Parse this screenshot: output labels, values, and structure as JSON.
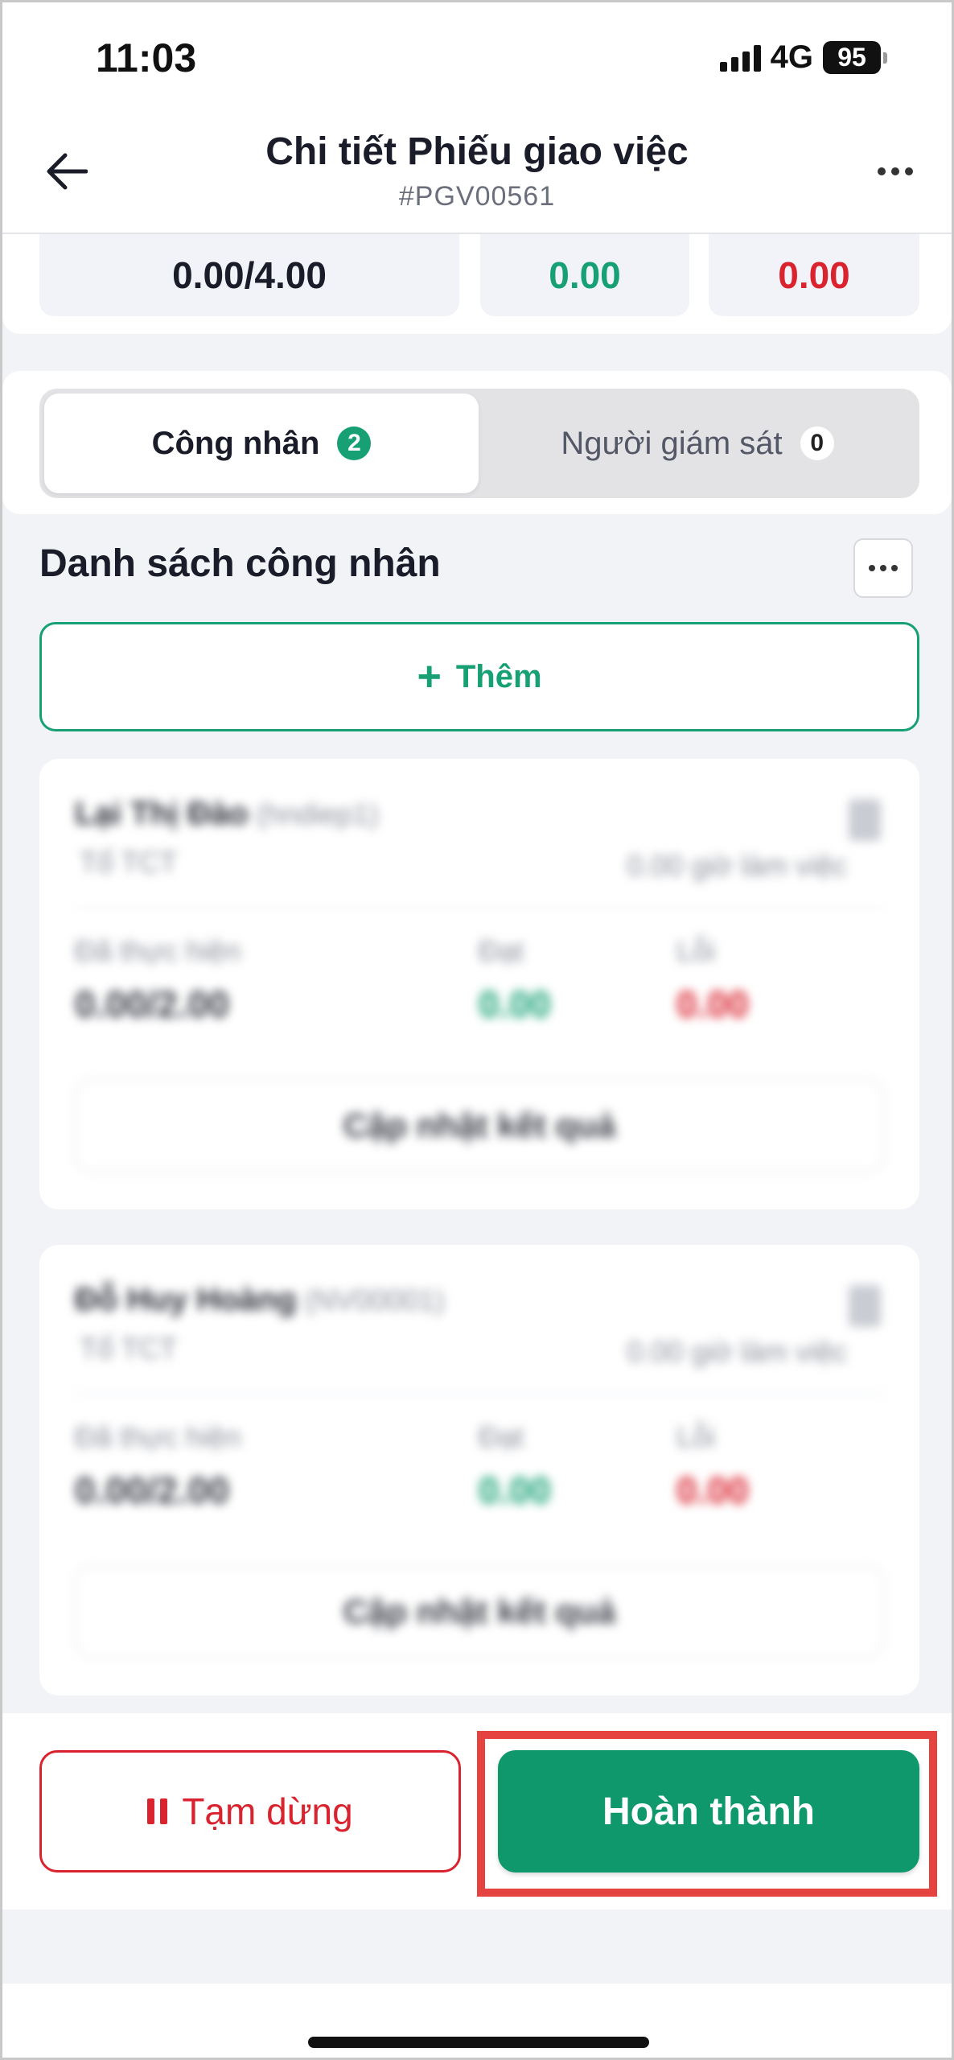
{
  "status_bar": {
    "time": "11:03",
    "network": "4G",
    "battery": "95"
  },
  "header": {
    "title": "Chi tiết Phiếu giao việc",
    "code": "#PGV00561"
  },
  "summary": {
    "done": "0.00/4.00",
    "pass": "0.00",
    "error": "0.00"
  },
  "tabs": [
    {
      "label": "Công nhân",
      "count": "2"
    },
    {
      "label": "Người giám sát",
      "count": "0"
    }
  ],
  "workers_section": {
    "title": "Danh sách công nhân",
    "add_label": "Thêm"
  },
  "workers": [
    {
      "name": "Lại Thị Đào",
      "code": "(hndiep1)",
      "team": "Tổ TCT",
      "hours": "0.00 giờ làm việc",
      "done_label": "Đã thực hiện",
      "done": "0.00/2.00",
      "pass_label": "Đạt",
      "pass": "0.00",
      "error_label": "Lỗi",
      "error": "0.00",
      "update_label": "Cập nhật kết quả"
    },
    {
      "name": "Đỗ Huy Hoàng",
      "code": "(NV00001)",
      "team": "Tổ TCT",
      "hours": "0.00 giờ làm việc",
      "done_label": "Đã thực hiện",
      "done": "0.00/2.00",
      "pass_label": "Đạt",
      "pass": "0.00",
      "error_label": "Lỗi",
      "error": "0.00",
      "update_label": "Cập nhật kết quả"
    }
  ],
  "actions": {
    "pause_label": "Tạm dừng",
    "complete_label": "Hoàn thành"
  },
  "colors": {
    "primary": "#10986d",
    "danger": "#d9232e",
    "highlight": "#e4433f"
  }
}
